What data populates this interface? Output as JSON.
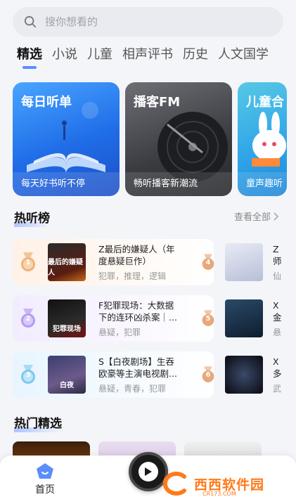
{
  "search": {
    "placeholder": "搜你想看的"
  },
  "tabs": [
    {
      "label": "精选",
      "active": true
    },
    {
      "label": "小说"
    },
    {
      "label": "儿童"
    },
    {
      "label": "相声评书"
    },
    {
      "label": "历史"
    },
    {
      "label": "人文国学"
    }
  ],
  "banners": [
    {
      "title": "每日听单",
      "subtitle": "每天好书听不停"
    },
    {
      "title": "播客FM",
      "subtitle": "畅听播客新潮流"
    },
    {
      "title": "儿童合",
      "subtitle": "童声趣听"
    }
  ],
  "hot_section": {
    "title": "热听榜",
    "see_all": "查看全部"
  },
  "ranks_left": [
    {
      "rank": "1",
      "cover_text": "最后的嫌疑人",
      "title": "Z最后的嫌疑人（年度悬疑巨作）",
      "tags": "犯罪，推理，逻辑"
    },
    {
      "rank": "2",
      "cover_text": "犯罪现场",
      "title": "F犯罪现场：大数据下的连环凶杀案｜...",
      "tags": "悬疑，犯罪"
    },
    {
      "rank": "3",
      "cover_text": "白夜",
      "title": "S【白夜剧场】生吞欧豪等主演电视剧...",
      "tags": "悬疑，青春，犯罪"
    }
  ],
  "ranks_right": [
    {
      "rank": "4",
      "title": "Z师",
      "tags": "仙"
    },
    {
      "rank": "5",
      "title": "X金",
      "tags": "悬"
    },
    {
      "rank": "6",
      "title": "X多",
      "tags": "武"
    }
  ],
  "featured_section": {
    "title": "热门精选"
  },
  "bottom_nav": {
    "home_label": "首页"
  },
  "watermark": {
    "text": "西西软件园",
    "sub": "CR173.COM"
  },
  "colors": {
    "accent": "#5b8dff",
    "bg": "#f4f5f9"
  }
}
